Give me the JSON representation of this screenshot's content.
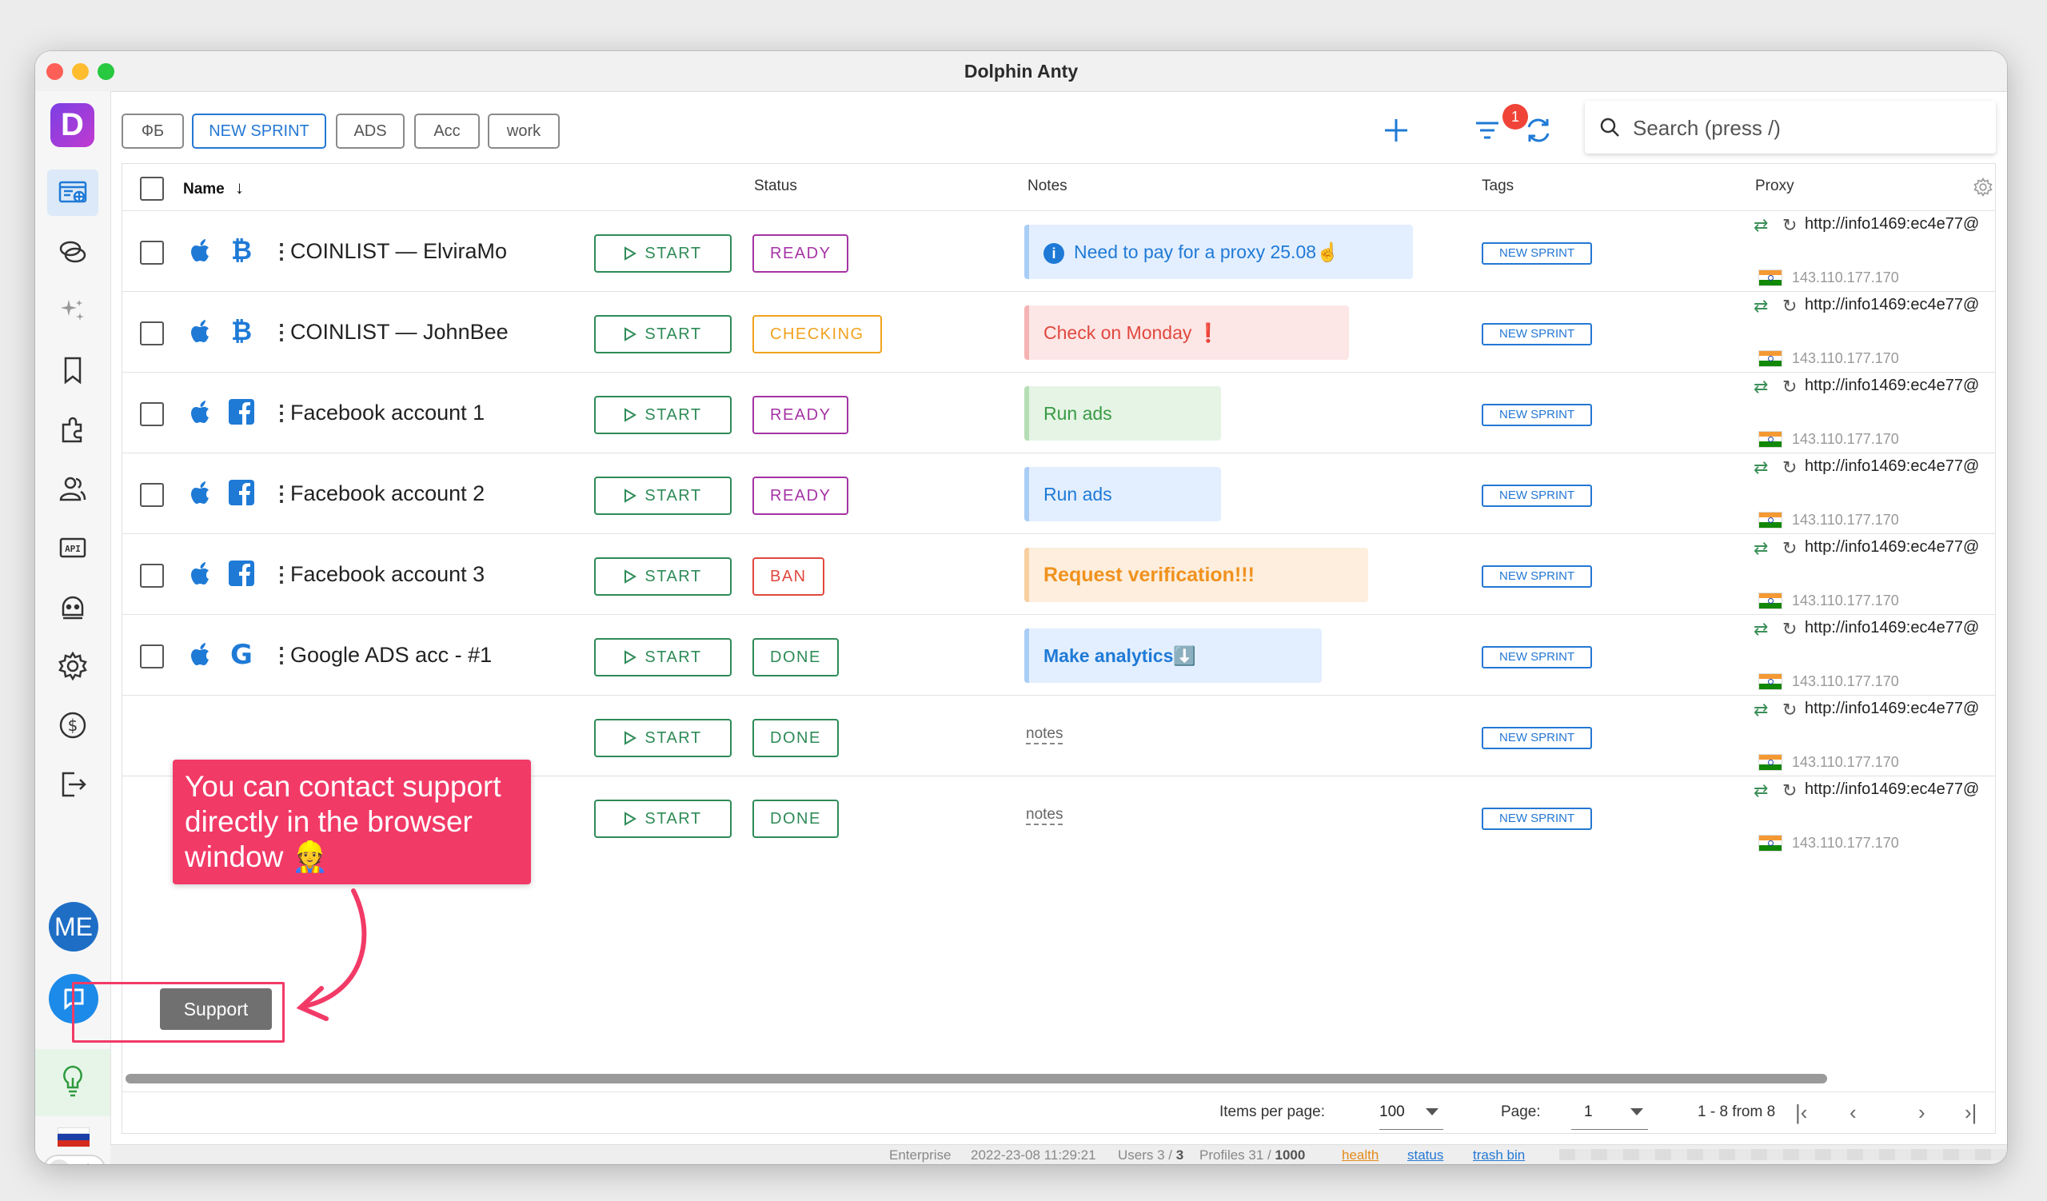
{
  "window": {
    "title": "Dolphin Anty"
  },
  "logo": "D",
  "sidebar": {
    "icons": [
      "browser-profiles-icon",
      "proxies-icon",
      "automation-icon",
      "bookmarks-icon",
      "extensions-icon",
      "users-icon",
      "api-icon",
      "robot-icon",
      "settings-icon",
      "billing-icon",
      "logout-icon"
    ],
    "avatar": "ME"
  },
  "filters": [
    "ФБ",
    "NEW SPRINT",
    "ADS",
    "Acc",
    "work"
  ],
  "toolbar": {
    "filter_badge": "1"
  },
  "search": {
    "placeholder": "Search (press /)"
  },
  "table": {
    "headers": {
      "name": "Name",
      "status": "Status",
      "notes": "Notes",
      "tags": "Tags",
      "proxy": "Proxy"
    },
    "start_label": "START",
    "rows": [
      {
        "name": "COINLIST — ElviraMo",
        "service": "bitcoin",
        "status": "READY",
        "note": "Need to pay for a proxy 25.08☝️",
        "tag": "NEW SPRINT",
        "proxy": "http://info1469:ec4e77@",
        "ip": "143.110.177.170"
      },
      {
        "name": "COINLIST — JohnBee",
        "service": "bitcoin",
        "status": "CHECKING",
        "note": "Check on Monday ❗",
        "tag": "NEW SPRINT",
        "proxy": "http://info1469:ec4e77@",
        "ip": "143.110.177.170"
      },
      {
        "name": "Facebook account 1",
        "service": "facebook",
        "status": "READY",
        "note": "Run ads",
        "tag": "NEW SPRINT",
        "proxy": "http://info1469:ec4e77@",
        "ip": "143.110.177.170"
      },
      {
        "name": "Facebook account 2",
        "service": "facebook",
        "status": "READY",
        "note": "Run ads",
        "tag": "NEW SPRINT",
        "proxy": "http://info1469:ec4e77@",
        "ip": "143.110.177.170"
      },
      {
        "name": "Facebook account 3",
        "service": "facebook",
        "status": "BAN",
        "note": "Request verification!!!",
        "tag": "NEW SPRINT",
        "proxy": "http://info1469:ec4e77@",
        "ip": "143.110.177.170"
      },
      {
        "name": "Google ADS acc - #1",
        "service": "google",
        "status": "DONE",
        "note": "Make analytics⬇️",
        "tag": "NEW SPRINT",
        "proxy": "http://info1469:ec4e77@",
        "ip": "143.110.177.170"
      },
      {
        "name": "",
        "service": "",
        "status": "DONE",
        "note": "notes",
        "tag": "NEW SPRINT",
        "proxy": "http://info1469:ec4e77@",
        "ip": "143.110.177.170"
      },
      {
        "name": "",
        "service": "",
        "status": "DONE",
        "note": "notes",
        "tag": "NEW SPRINT",
        "proxy": "http://info1469:ec4e77@",
        "ip": "143.110.177.170"
      }
    ]
  },
  "paginator": {
    "items_label": "Items per page:",
    "items_value": "100",
    "page_label": "Page:",
    "page_value": "1",
    "range": "1 - 8 from 8"
  },
  "statusbar": {
    "plan": "Enterprise",
    "datetime": "2022-23-08 11:29:21",
    "users_label": "Users 3 /",
    "users_max": "3",
    "profiles_label": "Profiles 31 /",
    "profiles_max": "1000",
    "health": "health",
    "status": "status",
    "trash": "trash bin"
  },
  "overlay": {
    "callout": "You can contact support directly in the browser window 👷",
    "support_label": "Support"
  },
  "colors": {
    "accent": "#2478d4",
    "start_green": "#2e8b57",
    "ready": "#a533a5",
    "checking": "#f0a21e",
    "ban": "#e0483e",
    "done": "#2e8b57",
    "callout": "#f23a67"
  }
}
